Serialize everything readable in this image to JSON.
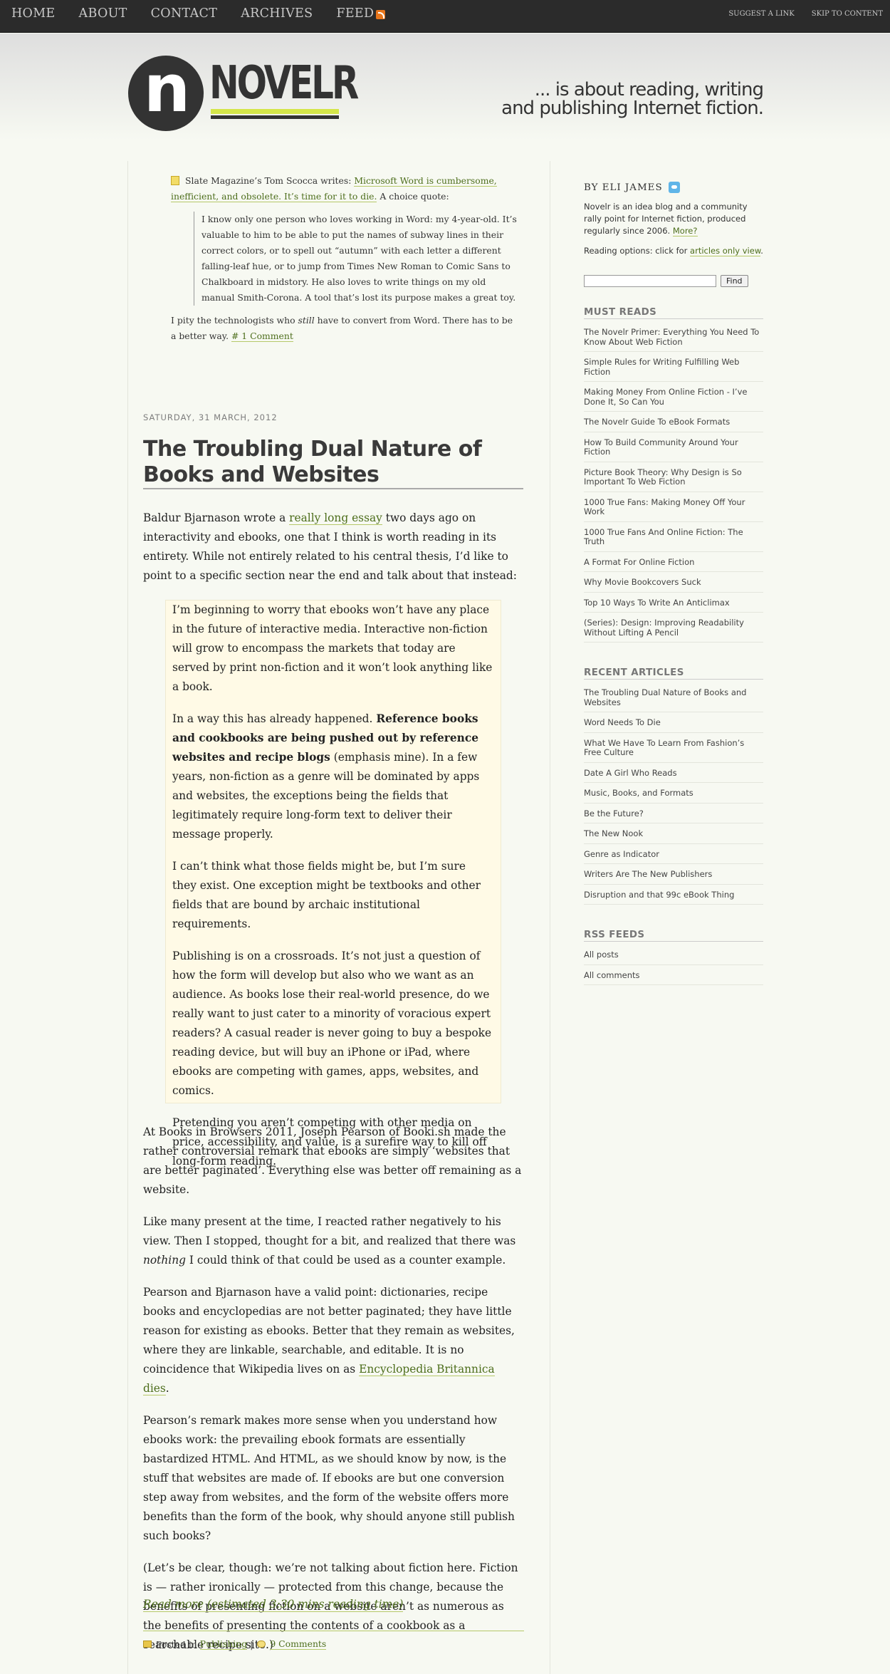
{
  "topnav": {
    "items": [
      "Home",
      "About",
      "Contact",
      "Archives",
      "Feed"
    ],
    "right_links": [
      "Suggest a Link",
      "Skip to Content"
    ]
  },
  "header": {
    "logo_letter": "n",
    "logo_word": "NOVELR",
    "tagline": "... is about reading, writing and publishing Internet fiction."
  },
  "aside": {
    "lead_before": "Slate Magazine’s Tom Scocca writes: ",
    "lead_link": "Microsoft Word is cumbersome, inefficient, and obsolete. It’s time for it to die.",
    "lead_after": " A choice quote:",
    "quote": "I know only one person who loves working in Word: my 4-year-old. It’s valuable to him to be able to put the names of subway lines in their correct colors, or to spell out “autumn” with each letter a different falling-leaf hue, or to jump from Times New Roman to Comic Sans to Chalkboard in midstory. He also loves to write things on my old manual Smith-Corona. A tool that’s lost its purpose makes a great toy.",
    "closing_before": "I pity the technologists who ",
    "closing_em": "still",
    "closing_after": " have to convert from Word. There has to be a better way. ",
    "comment_link": "# 1 Comment"
  },
  "article": {
    "date": "Saturday, 31 March, 2012",
    "title": "The Troubling Dual Nature of Books and Websites",
    "intro_before": "Baldur Bjarnason wrote a ",
    "intro_link": "really long essay",
    "intro_after": " two days ago on interactivity and ebooks, one that I think is worth reading in its entirety. While not entirely related to his central thesis, I’d like to point to a specific section near the end and talk about that instead:",
    "bq1": "I’m beginning to worry that ebooks won’t have any place in the future of interactive media. Interactive non-fiction will grow to encompass the markets that today are served by print non-fiction and it won’t look anything like a book.",
    "bq2_before": "In a way this has already happened. ",
    "bq2_bold": "Reference books and cookbooks are being pushed out by reference websites and recipe blogs",
    "bq2_after": " (emphasis mine). In a few years, non-fiction as a genre will be dominated by apps and websites, the exceptions being the fields that legitimately require long-form text to deliver their message properly.",
    "bq3": "I can’t think what those fields might be, but I’m sure they exist. One exception might be textbooks and other fields that are bound by archaic institutional requirements.",
    "bq4": "Publishing is on a crossroads. It’s not just a question of how the form will develop but also who we want as an audience. As books lose their real-world presence, do we really want to just cater to a minority of voracious expert readers? A casual reader is never going to buy a bespoke reading device, but will buy an iPhone or iPad, where ebooks are competing with games, apps, websites, and comics.",
    "bq5": "Pretending you aren’t competing with other media on price, accessibility, and value, is a surefire way to kill off long-form reading.",
    "p1": "At Books in Browsers 2011, Joseph Pearson of Booki.sh made the rather controversial remark that ebooks are simply ‘websites that are better paginated’. Everything else was better off remaining as a website.",
    "p2_before": "Like many present at the time, I reacted rather negatively to his view. Then I stopped, thought for a bit, and realized that there was ",
    "p2_em": "nothing",
    "p2_after": " I could think of that could be used as a counter example.",
    "p3_before": "Pearson and Bjarnason have a valid point: dictionaries, recipe books and encyclopedias are not better paginated; they have little reason for existing as ebooks. Better that they remain as websites, where they are linkable, searchable, and editable. It is no coincidence that Wikipedia lives on as ",
    "p3_link": "Encyclopedia Britannica dies",
    "p3_after": ".",
    "p4": "Pearson’s remark makes more sense when you understand how ebooks work: the prevailing ebook formats are essentially bastardized HTML. And HTML, as we should know by now, is the stuff that websites are made of. If ebooks are but one conversion step away from websites, and the form of the website offers more benefits than the form of the book, why should anyone still publish such books?",
    "p5": "(Let’s be clear, though: we’re not talking about fiction here. Fiction is — rather ironically — protected from this change, because the benefits of presenting fiction on a website aren’t as numerous as the benefits of presenting the contents of a cookbook as a searchable recipe site.)",
    "read_more": "Read more (estimated 3:30 mins reading time)",
    "posted_in": "Posted in",
    "category": "Publishing",
    "separator": "|",
    "comments": "9 Comments"
  },
  "sidebar": {
    "author": "By Eli James",
    "about_before": "Novelr is an idea blog and a community rally point for Internet fiction, produced regularly since 2006. ",
    "about_link": "More?",
    "options_before": "Reading options: click for ",
    "options_link": "articles only view",
    "options_after": ".",
    "search_placeholder": "",
    "find_label": "Find",
    "must_reads_heading": "Must Reads",
    "must_reads": [
      "The Novelr Primer: Everything You Need To Know About Web Fiction",
      "Simple Rules for Writing Fulfilling Web Fiction",
      "Making Money From Online Fiction - I’ve Done It, So Can You",
      "The Novelr Guide To eBook Formats",
      "How To Build Community Around Your Fiction",
      "Picture Book Theory: Why Design is So Important To Web Fiction",
      "1000 True Fans: Making Money Off Your Work",
      "1000 True Fans And Online Fiction: The Truth",
      "A Format For Online Fiction",
      "Why Movie Bookcovers Suck",
      "Top 10 Ways To Write An Anticlimax",
      "(Series): Design: Improving Readability Without Lifting A Pencil"
    ],
    "recent_heading": "Recent Articles",
    "recent": [
      "The Troubling Dual Nature of Books and Websites",
      "Word Needs To Die",
      "What We Have To Learn From Fashion’s Free Culture",
      "Date A Girl Who Reads",
      "Music, Books, and Formats",
      "Be the Future?",
      "The New Nook",
      "Genre as Indicator",
      "Writers Are The New Publishers",
      "Disruption and that 99c eBook Thing"
    ],
    "rss_heading": "RSS Feeds",
    "rss": [
      "All posts",
      "All comments"
    ]
  },
  "colors": {
    "topbar": "#2b2b2b",
    "accent_green": "#4d6e1c",
    "logo_yellow": "#d4e64a",
    "quote_bg": "#fffae6"
  }
}
